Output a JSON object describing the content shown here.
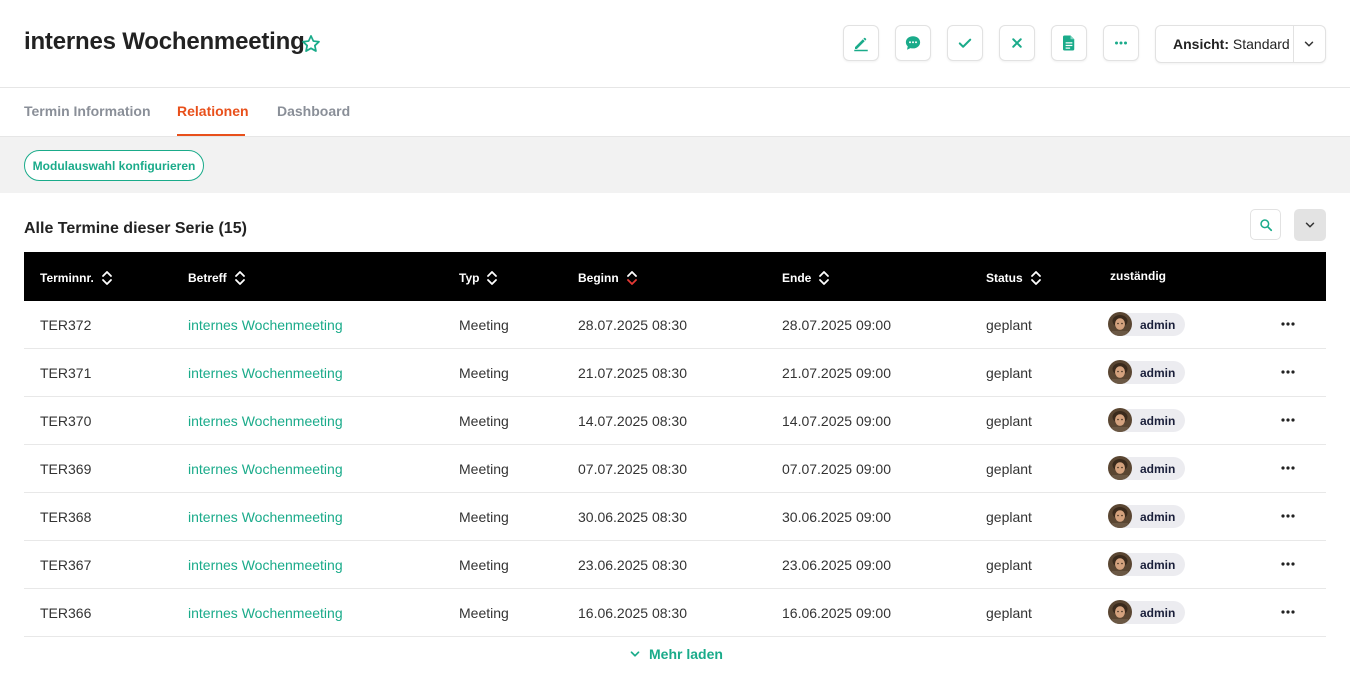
{
  "header": {
    "title": "internes Wochenmeeting",
    "toolbar": [
      {
        "name": "edit-button",
        "icon": "pencil-icon"
      },
      {
        "name": "comment-button",
        "icon": "chat-bubble-icon"
      },
      {
        "name": "confirm-button",
        "icon": "check-icon"
      },
      {
        "name": "cancel-button",
        "icon": "close-icon"
      },
      {
        "name": "document-button",
        "icon": "document-icon"
      },
      {
        "name": "more-button",
        "icon": "ellipsis-icon"
      }
    ],
    "view_select": {
      "label": "Ansicht:",
      "value": "Standard"
    }
  },
  "tabs": [
    {
      "label": "Termin Information",
      "active": false
    },
    {
      "label": "Relationen",
      "active": true
    },
    {
      "label": "Dashboard",
      "active": false
    }
  ],
  "config_button": "Modulauswahl konfigurieren",
  "section": {
    "title": "Alle Termine dieser Serie (15)"
  },
  "table": {
    "columns": [
      "Terminnr.",
      "Betreff",
      "Typ",
      "Beginn",
      "Ende",
      "Status",
      "zuständig"
    ],
    "sorted_column": "Beginn",
    "rows": [
      {
        "nr": "TER372",
        "betreff": "internes Wochenmeeting",
        "typ": "Meeting",
        "beginn": "28.07.2025 08:30",
        "ende": "28.07.2025 09:00",
        "status": "geplant",
        "user": "admin"
      },
      {
        "nr": "TER371",
        "betreff": "internes Wochenmeeting",
        "typ": "Meeting",
        "beginn": "21.07.2025 08:30",
        "ende": "21.07.2025 09:00",
        "status": "geplant",
        "user": "admin"
      },
      {
        "nr": "TER370",
        "betreff": "internes Wochenmeeting",
        "typ": "Meeting",
        "beginn": "14.07.2025 08:30",
        "ende": "14.07.2025 09:00",
        "status": "geplant",
        "user": "admin"
      },
      {
        "nr": "TER369",
        "betreff": "internes Wochenmeeting",
        "typ": "Meeting",
        "beginn": "07.07.2025 08:30",
        "ende": "07.07.2025 09:00",
        "status": "geplant",
        "user": "admin"
      },
      {
        "nr": "TER368",
        "betreff": "internes Wochenmeeting",
        "typ": "Meeting",
        "beginn": "30.06.2025 08:30",
        "ende": "30.06.2025 09:00",
        "status": "geplant",
        "user": "admin"
      },
      {
        "nr": "TER367",
        "betreff": "internes Wochenmeeting",
        "typ": "Meeting",
        "beginn": "23.06.2025 08:30",
        "ende": "23.06.2025 09:00",
        "status": "geplant",
        "user": "admin"
      },
      {
        "nr": "TER366",
        "betreff": "internes Wochenmeeting",
        "typ": "Meeting",
        "beginn": "16.06.2025 08:30",
        "ende": "16.06.2025 09:00",
        "status": "geplant",
        "user": "admin"
      }
    ]
  },
  "load_more": "Mehr laden",
  "colors": {
    "accent": "#1aab8a",
    "active_tab": "#e8501b",
    "sort_active": "#e53935",
    "header_bg": "#000000"
  }
}
